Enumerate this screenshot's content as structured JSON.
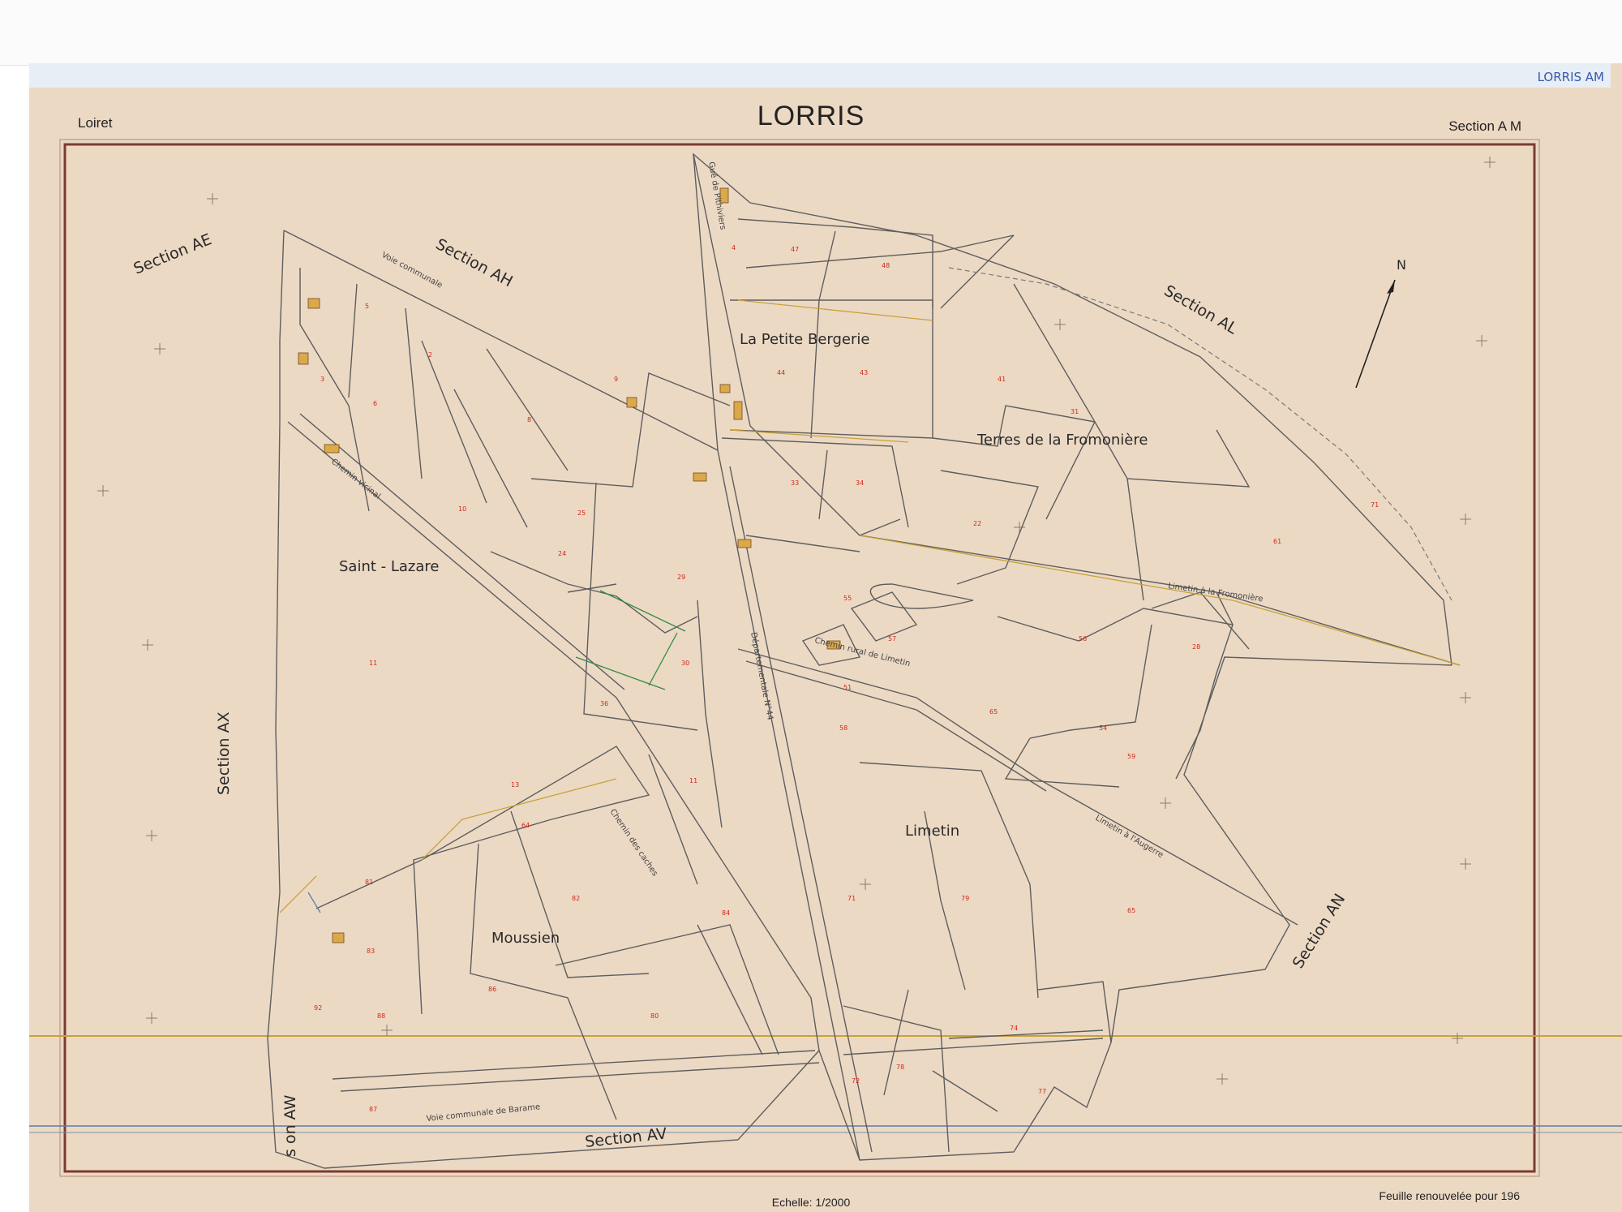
{
  "sheet": {
    "corner_tag": "LORRIS AM",
    "department": "Loiret",
    "commune": "LORRIS",
    "section": "Section A M",
    "scale": "Echelle: 1/2000",
    "renewal": "Feuille renouvelée pour 196"
  },
  "localities": {
    "petite_bergerie": "La Petite Bergerie",
    "fromoniere": "Terres de la Fromonière",
    "saint_lazare": "Saint - Lazare",
    "limetin": "Limetin",
    "moussien": "Moussien"
  },
  "neighbour_sections": {
    "ae": "Section AE",
    "ah": "Section AH",
    "al": "Section AL",
    "ax": "Section AX",
    "an": "Section AN",
    "av": "Section AV",
    "aw": "s on AW"
  },
  "roads": {
    "voie_communale": "Voie communale",
    "chemin_vicinal": "Chemin vicinal",
    "gue_pithiviers": "Gué de Pithiviers",
    "departementale": "Départementale N°44",
    "chemin_rural_limetin": "Chemin rural de Limetin",
    "limetin_fromoniere": "Limetin à la Fromonière",
    "limetin_augerre": "Limetin à l'Augerre",
    "voie_barame": "Voie communale de Barame",
    "chemin_des_caches": "Chemin des caches"
  },
  "compass": {
    "label": "N"
  },
  "colors": {
    "paper": "#ecd9c4",
    "frame": "#7a3c32",
    "parcel_line": "#5e5e5e",
    "parcel_number": "#cc2a1d",
    "green_line": "#2e8a4a",
    "yellow_line": "#c8a238",
    "blue_line": "#5a7ea8"
  }
}
